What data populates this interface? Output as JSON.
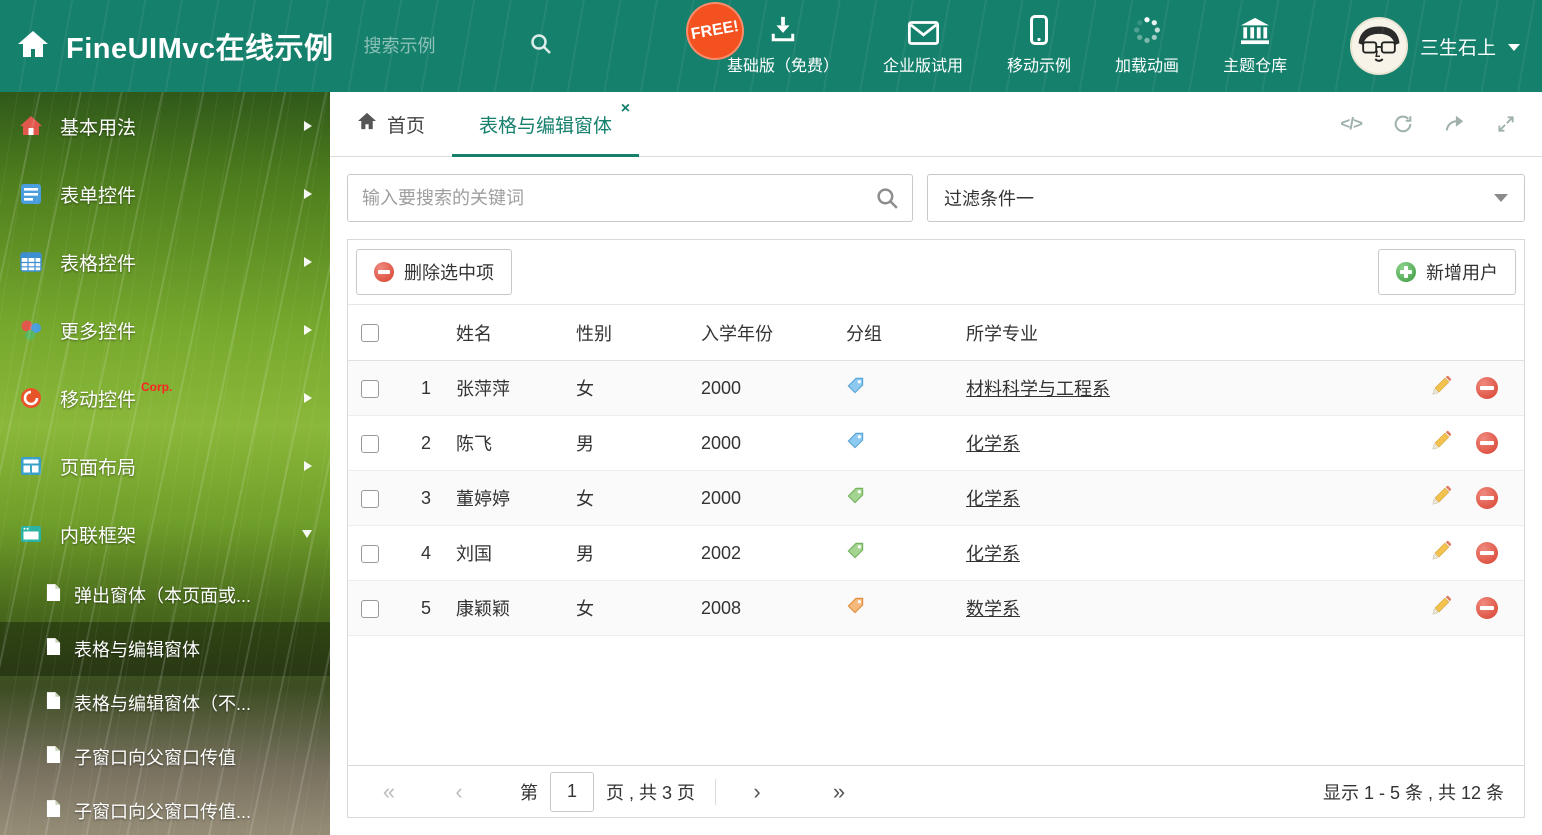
{
  "colors": {
    "header_bg": "#15806c",
    "accent": "#17806d",
    "free_badge": "#f3511f",
    "delete_red": "#d8402f",
    "add_green": "#3c9a40",
    "tag_blue": "#8ecaef",
    "tag_green": "#a5d491",
    "tag_orange": "#f5b97c"
  },
  "header": {
    "title": "FineUIMvc在线示例",
    "search_placeholder": "搜索示例",
    "free_badge": "FREE!",
    "nav_items": [
      {
        "label": "基础版（免费）",
        "icon": "download-icon"
      },
      {
        "label": "企业版试用",
        "icon": "envelope-icon"
      },
      {
        "label": "移动示例",
        "icon": "mobile-icon"
      },
      {
        "label": "加载动画",
        "icon": "spinner-icon"
      },
      {
        "label": "主题仓库",
        "icon": "bank-icon"
      }
    ],
    "user_name": "三生石上"
  },
  "sidebar": {
    "items": [
      {
        "label": "基本用法",
        "icon": "house-icon",
        "state": "collapsed"
      },
      {
        "label": "表单控件",
        "icon": "form-icon",
        "state": "collapsed"
      },
      {
        "label": "表格控件",
        "icon": "table-icon",
        "state": "collapsed"
      },
      {
        "label": "更多控件",
        "icon": "widgets-icon",
        "state": "collapsed"
      },
      {
        "label": "移动控件",
        "icon": "mobile-swirl-icon",
        "badge": "Corp.",
        "state": "collapsed"
      },
      {
        "label": "页面布局",
        "icon": "layout-icon",
        "state": "collapsed"
      },
      {
        "label": "内联框架",
        "icon": "iframe-icon",
        "state": "expanded"
      }
    ],
    "subitems": [
      {
        "label": "弹出窗体（本页面或...",
        "active": false
      },
      {
        "label": "表格与编辑窗体",
        "active": true
      },
      {
        "label": "表格与编辑窗体（不...",
        "active": false
      },
      {
        "label": "子窗口向父窗口传值",
        "active": false
      },
      {
        "label": "子窗口向父窗口传值...",
        "active": false
      }
    ]
  },
  "tabs": [
    {
      "label": "首页",
      "active": false
    },
    {
      "label": "表格与编辑窗体",
      "active": true,
      "closable": true
    }
  ],
  "tab_tools": [
    {
      "icon": "code-icon"
    },
    {
      "icon": "refresh-icon"
    },
    {
      "icon": "share-icon"
    },
    {
      "icon": "expand-icon"
    }
  ],
  "filters": {
    "search_placeholder": "输入要搜索的关键词",
    "filter_value": "过滤条件一"
  },
  "toolbar": {
    "delete_label": "删除选中项",
    "add_label": "新增用户"
  },
  "table": {
    "columns": [
      "姓名",
      "性别",
      "入学年份",
      "分组",
      "所学专业"
    ],
    "rows": [
      {
        "num": "1",
        "name": "张萍萍",
        "gender": "女",
        "year": "2000",
        "tag_color": "blue",
        "major": "材料科学与工程系"
      },
      {
        "num": "2",
        "name": "陈飞",
        "gender": "男",
        "year": "2000",
        "tag_color": "blue",
        "major": "化学系"
      },
      {
        "num": "3",
        "name": "董婷婷",
        "gender": "女",
        "year": "2000",
        "tag_color": "green",
        "major": "化学系"
      },
      {
        "num": "4",
        "name": "刘国",
        "gender": "男",
        "year": "2002",
        "tag_color": "green",
        "major": "化学系"
      },
      {
        "num": "5",
        "name": "康颖颖",
        "gender": "女",
        "year": "2008",
        "tag_color": "orange",
        "major": "数学系"
      }
    ]
  },
  "pagination": {
    "prefix": "第",
    "page": "1",
    "suffix": "页 , 共 3 页",
    "summary": "显示 1 - 5 条 , 共 12 条"
  }
}
